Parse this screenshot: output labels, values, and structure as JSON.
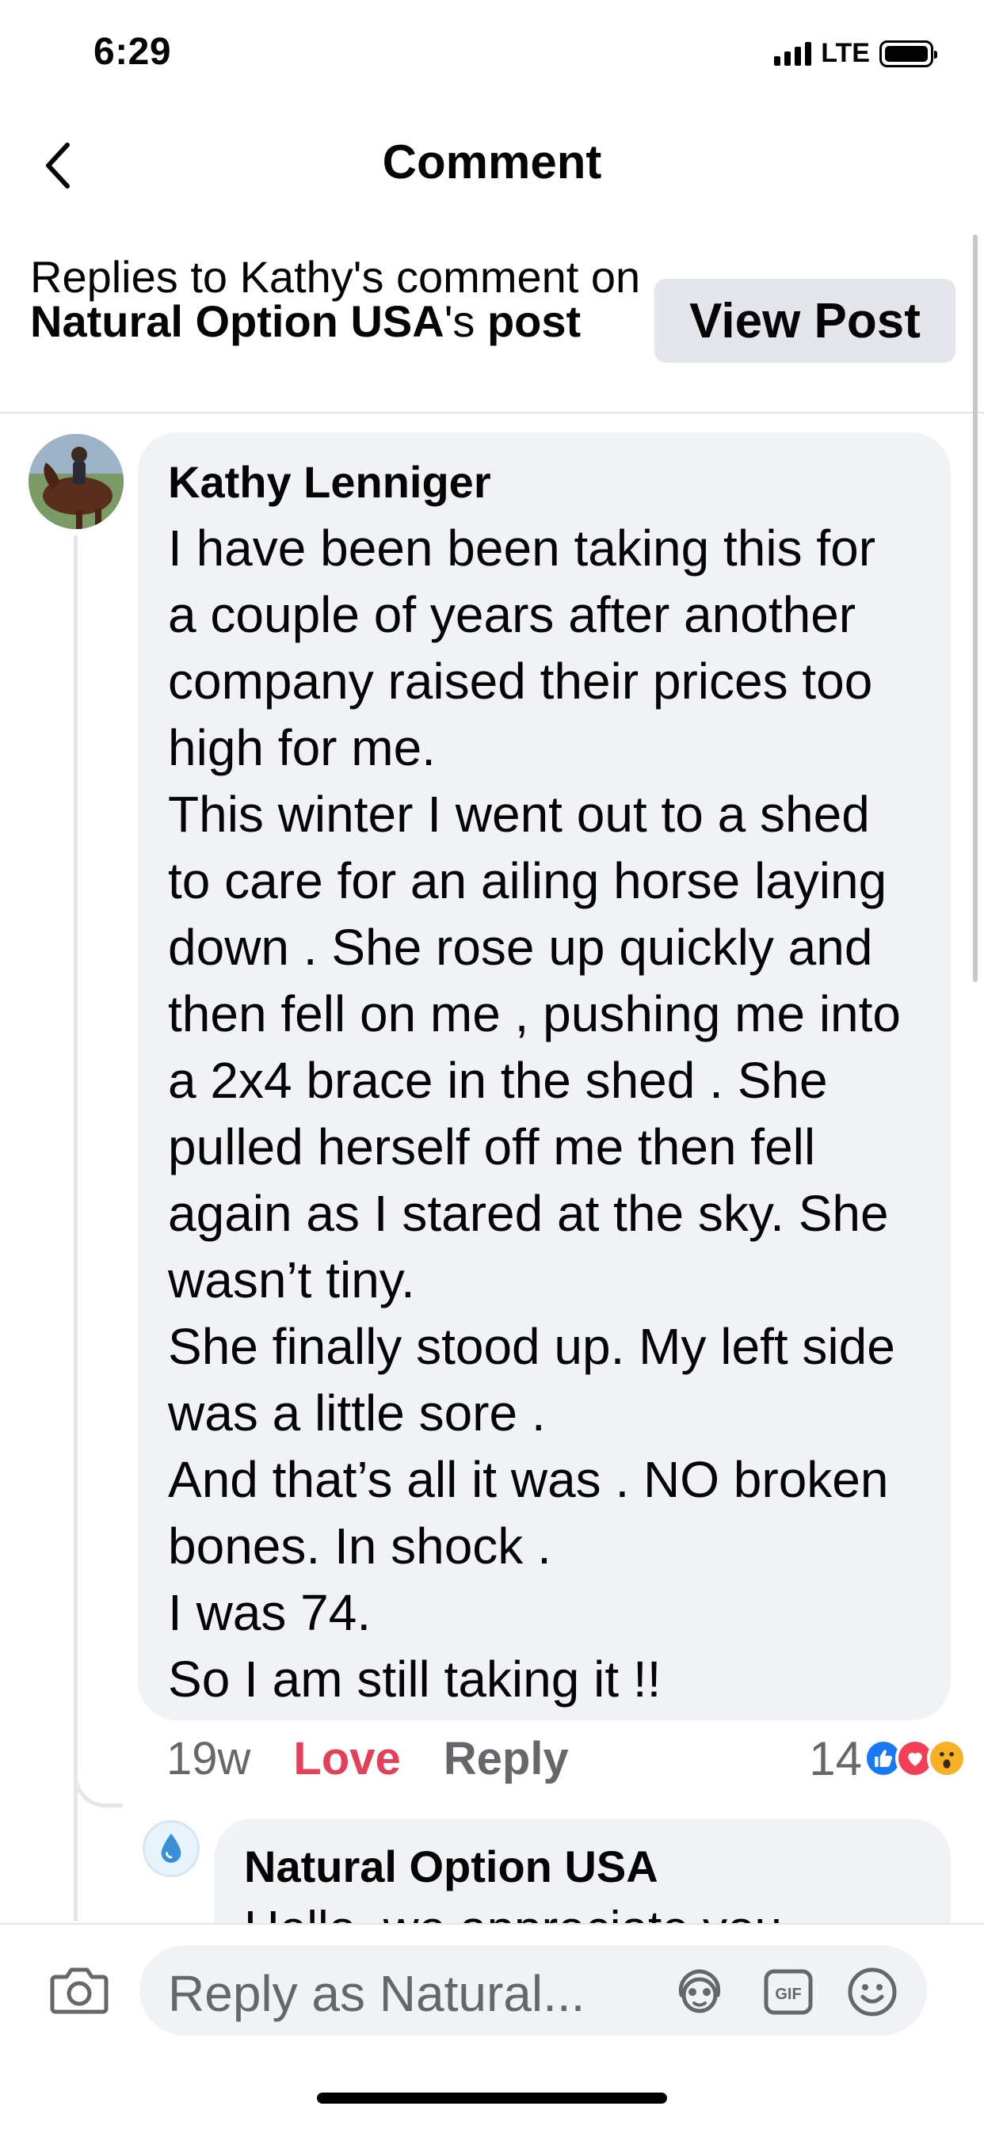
{
  "status_bar": {
    "time": "6:29",
    "network": "LTE"
  },
  "nav": {
    "title": "Comment",
    "back_icon": "chevron-left-icon"
  },
  "context": {
    "prefix": "Replies to Kathy's comment on ",
    "page_name": "Natural Option USA",
    "suffix": "'s ",
    "post_word": "post",
    "view_post_label": "View Post"
  },
  "comment": {
    "author": "Kathy Lenniger",
    "lines": [
      "I have been been taking this for",
      "a couple of years after another",
      "company raised their prices too",
      "high for me.",
      "This winter I went out to a shed",
      "to care for an ailing horse laying",
      "down . She rose up quickly and",
      "then fell on me , pushing me into",
      "a 2x4 brace in the shed . She",
      "pulled herself off me then fell",
      "again as I stared at the sky. She",
      "wasn’t tiny.",
      "She finally stood up. My left side",
      "was a little sore .",
      "And that’s all it was . NO broken",
      "bones. In shock .",
      "I was 74.",
      "So I am still taking it !!"
    ],
    "time": "19w",
    "reaction_label": "Love",
    "reply_label": "Reply",
    "reaction_count": "14",
    "reaction_icons": [
      "like-icon",
      "love-icon",
      "wow-icon"
    ]
  },
  "reply": {
    "author": "Natural Option USA",
    "text_partial": "Hello, we appreciate you"
  },
  "composer": {
    "placeholder": "Reply as Natural...",
    "icons": [
      "camera-icon",
      "avatar-sticker-icon",
      "gif-icon",
      "emoji-icon"
    ]
  },
  "colors": {
    "love": "#e4405a",
    "like": "#1877f2",
    "bubble": "#f0f2f5",
    "secondary_text": "#65676b"
  }
}
